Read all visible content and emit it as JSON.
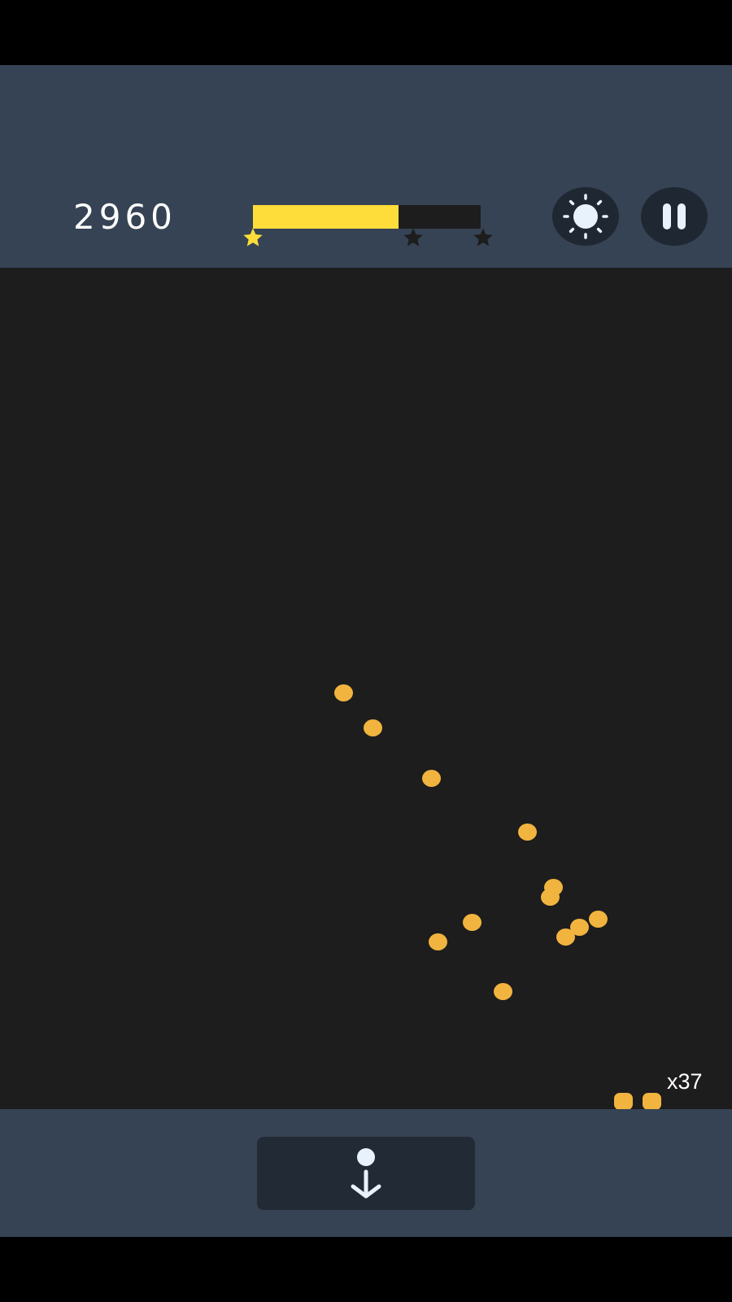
{
  "game": {
    "score": "2960",
    "level_progress": 0.64,
    "stars_earned": 1,
    "stars_total": 3,
    "ball_count_label": "x37"
  },
  "colors": {
    "top_bar": "#364354",
    "play_area": "#1d1d1d",
    "progress_fill": "#fedd3a",
    "progress_track": "#1d1d1d",
    "star_earned": "#fedd3a",
    "star_unearned": "#1d1d1d",
    "ball": "#f1b43f",
    "button_bg": "#1e2732",
    "drop_button_bg": "#222a35",
    "icon": "#e8f2fc"
  },
  "icons": {
    "brightness": "sun-icon",
    "pause": "pause-icon",
    "drop": "drop-down-arrow-icon",
    "star": "star-icon"
  }
}
